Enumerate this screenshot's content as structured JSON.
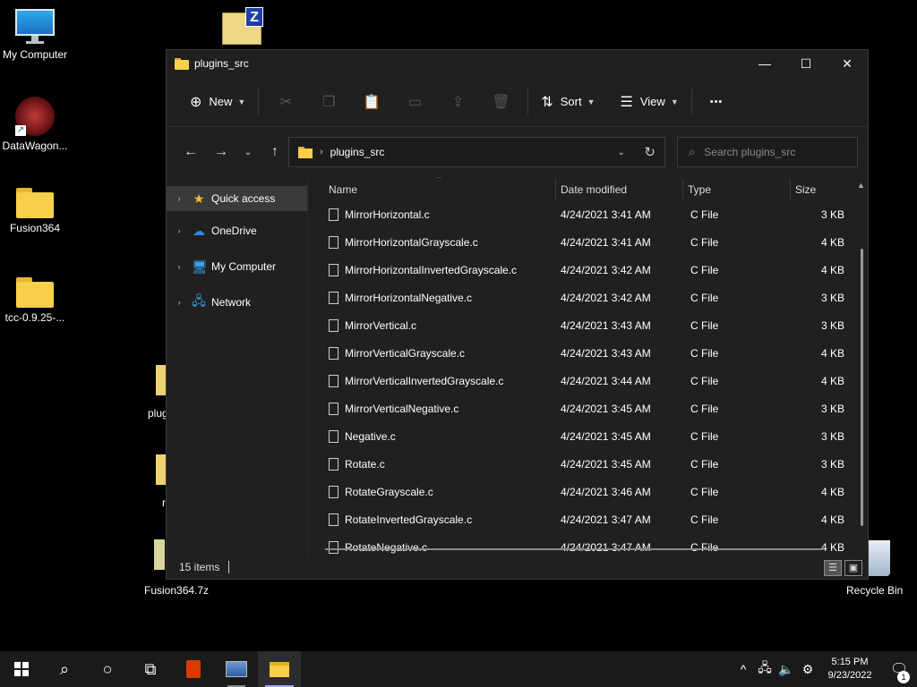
{
  "desktop": {
    "icons": [
      {
        "label": "My Computer"
      },
      {
        "label": "DataWagon..."
      },
      {
        "label": "Fusion364"
      },
      {
        "label": "tcc-0.9.25-..."
      },
      {
        "label": "Recycle Bin"
      },
      {
        "label": "Fusion364.7z"
      }
    ],
    "peek_labels": [
      "plug",
      "r"
    ]
  },
  "window": {
    "title": "plugins_src",
    "controls": {
      "minimize": "—",
      "maximize": "☐",
      "close": "✕"
    },
    "toolbar": {
      "new_label": "New",
      "sort_label": "Sort",
      "view_label": "View",
      "more_label": "•••"
    },
    "address": {
      "path": "plugins_src"
    },
    "search": {
      "placeholder": "Search plugins_src"
    },
    "sidebar": [
      {
        "label": "Quick access"
      },
      {
        "label": "OneDrive"
      },
      {
        "label": "My Computer"
      },
      {
        "label": "Network"
      }
    ],
    "columns": {
      "name": "Name",
      "date": "Date modified",
      "type": "Type",
      "size": "Size"
    },
    "files": [
      {
        "name": "MirrorHorizontal.c",
        "date": "4/24/2021 3:41 AM",
        "type": "C File",
        "size": "3 KB"
      },
      {
        "name": "MirrorHorizontalGrayscale.c",
        "date": "4/24/2021 3:41 AM",
        "type": "C File",
        "size": "4 KB"
      },
      {
        "name": "MirrorHorizontalInvertedGrayscale.c",
        "date": "4/24/2021 3:42 AM",
        "type": "C File",
        "size": "4 KB"
      },
      {
        "name": "MirrorHorizontalNegative.c",
        "date": "4/24/2021 3:42 AM",
        "type": "C File",
        "size": "3 KB"
      },
      {
        "name": "MirrorVertical.c",
        "date": "4/24/2021 3:43 AM",
        "type": "C File",
        "size": "3 KB"
      },
      {
        "name": "MirrorVerticalGrayscale.c",
        "date": "4/24/2021 3:43 AM",
        "type": "C File",
        "size": "4 KB"
      },
      {
        "name": "MirrorVerticalInvertedGrayscale.c",
        "date": "4/24/2021 3:44 AM",
        "type": "C File",
        "size": "4 KB"
      },
      {
        "name": "MirrorVerticalNegative.c",
        "date": "4/24/2021 3:45 AM",
        "type": "C File",
        "size": "3 KB"
      },
      {
        "name": "Negative.c",
        "date": "4/24/2021 3:45 AM",
        "type": "C File",
        "size": "3 KB"
      },
      {
        "name": "Rotate.c",
        "date": "4/24/2021 3:45 AM",
        "type": "C File",
        "size": "3 KB"
      },
      {
        "name": "RotateGrayscale.c",
        "date": "4/24/2021 3:46 AM",
        "type": "C File",
        "size": "4 KB"
      },
      {
        "name": "RotateInvertedGrayscale.c",
        "date": "4/24/2021 3:47 AM",
        "type": "C File",
        "size": "4 KB"
      },
      {
        "name": "RotateNegative.c",
        "date": "4/24/2021 3:47 AM",
        "type": "C File",
        "size": "4 KB"
      }
    ],
    "status": {
      "items": "15 items"
    }
  },
  "taskbar": {
    "clock_time": "5:15 PM",
    "clock_date": "9/23/2022",
    "notification_count": "1"
  },
  "colors": {
    "accent": "#a6a6ff",
    "folder": "#f7cf4a",
    "window_bg": "#202020"
  }
}
